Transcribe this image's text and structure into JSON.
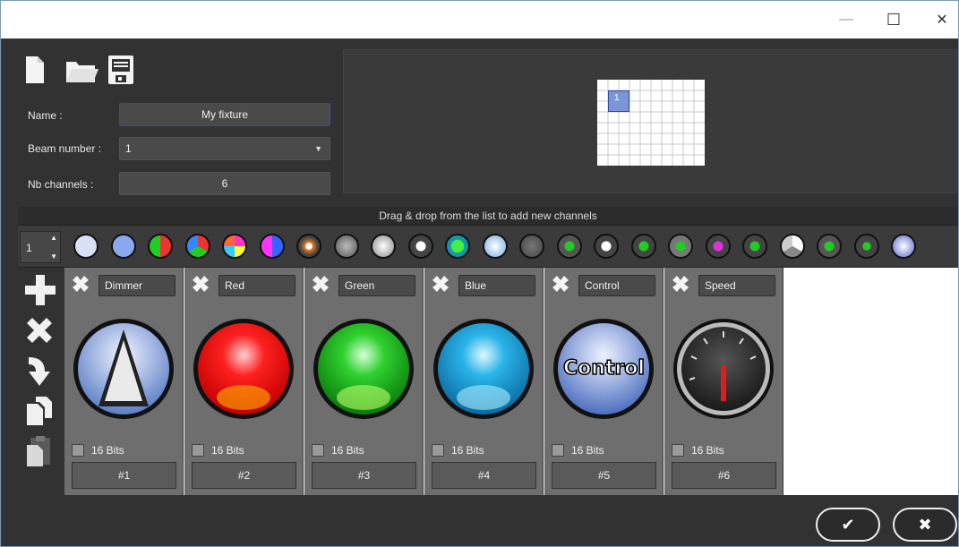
{
  "window": {
    "title": "",
    "minimize_glyph": "—",
    "maximize_glyph": "☐",
    "close_glyph": "✕"
  },
  "toolbar": {
    "icons": [
      "new-file-icon",
      "open-folder-icon",
      "save-disk-icon"
    ]
  },
  "form": {
    "name_label": "Name :",
    "name_value": "My fixture",
    "beam_label": "Beam number :",
    "beam_value": "1",
    "channels_label": "Nb channels :",
    "channels_value": "6"
  },
  "preview": {
    "cell_label": "1",
    "accent": "#7b96d8"
  },
  "palette": {
    "hint": "Drag & drop from the list to add new channels",
    "spinner_value": "1",
    "icons": [
      "dimmer-icon",
      "dimmer-alt-icon",
      "red-green-icon",
      "rgb-icon",
      "color-wheel-icon",
      "pan-tilt-icon",
      "gobo-dimmer-icon",
      "speed-gauge-icon",
      "strobe-icon",
      "shutter-icon",
      "green-blob-icon",
      "zoom-icon",
      "gobo-ring-icon",
      "gobo-green-icon",
      "gobo-rotate-icon",
      "gobo-hash-icon",
      "gobo-arrow-icon",
      "gobo-dots-icon",
      "gobo-color-icon",
      "prism-icon",
      "pan-icon",
      "hash-icon",
      "help-icon"
    ]
  },
  "side_tools": [
    "add-channel-icon",
    "remove-channel-icon",
    "move-channel-icon",
    "copy-channel-icon",
    "paste-channel-icon"
  ],
  "channels": [
    {
      "name": "Dimmer",
      "bits": "16 Bits",
      "number": "#1",
      "type": "dimmer"
    },
    {
      "name": "Red",
      "bits": "16 Bits",
      "number": "#2",
      "type": "red"
    },
    {
      "name": "Green",
      "bits": "16 Bits",
      "number": "#3",
      "type": "green"
    },
    {
      "name": "Blue",
      "bits": "16 Bits",
      "number": "#4",
      "type": "blue"
    },
    {
      "name": "Control",
      "bits": "16 Bits",
      "number": "#5",
      "type": "control",
      "orb_text": "Control"
    },
    {
      "name": "Speed",
      "bits": "16 Bits",
      "number": "#6",
      "type": "speed"
    }
  ],
  "actions": {
    "ok_glyph": "✔",
    "cancel_glyph": "✖"
  }
}
